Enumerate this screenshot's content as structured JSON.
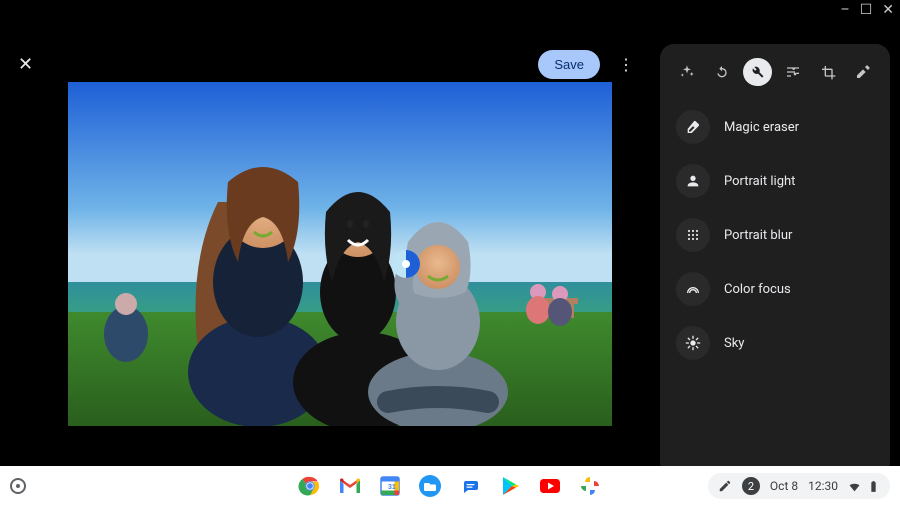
{
  "window_controls": {
    "minimize": "–",
    "maximize": "☐",
    "close": "✕"
  },
  "editor": {
    "close_label": "✕",
    "save_label": "Save",
    "overflow_label": "⋮"
  },
  "panel": {
    "tabs": [
      {
        "id": "suggestions",
        "name": "sparkle-icon"
      },
      {
        "id": "rotate",
        "name": "rotate-icon"
      },
      {
        "id": "tools",
        "name": "tools-icon",
        "active": true
      },
      {
        "id": "adjust",
        "name": "sliders-icon"
      },
      {
        "id": "crop",
        "name": "crop-icon"
      },
      {
        "id": "markup",
        "name": "markup-icon"
      }
    ],
    "tools": [
      {
        "id": "magic-eraser",
        "label": "Magic eraser",
        "icon": "eraser-icon"
      },
      {
        "id": "portrait-light",
        "label": "Portrait light",
        "icon": "person-icon"
      },
      {
        "id": "portrait-blur",
        "label": "Portrait blur",
        "icon": "grid-dots-icon"
      },
      {
        "id": "color-focus",
        "label": "Color focus",
        "icon": "rainbow-icon"
      },
      {
        "id": "sky",
        "label": "Sky",
        "icon": "sun-icon"
      }
    ]
  },
  "shelf": {
    "apps": [
      {
        "id": "chrome",
        "name": "chrome-icon"
      },
      {
        "id": "gmail",
        "name": "gmail-icon"
      },
      {
        "id": "calendar",
        "name": "calendar-icon"
      },
      {
        "id": "files",
        "name": "files-icon"
      },
      {
        "id": "messages",
        "name": "messages-icon"
      },
      {
        "id": "play",
        "name": "play-store-icon"
      },
      {
        "id": "youtube",
        "name": "youtube-icon"
      },
      {
        "id": "photos",
        "name": "photos-icon"
      }
    ],
    "notifications": "2",
    "date": "Oct 8",
    "time": "12:30"
  }
}
